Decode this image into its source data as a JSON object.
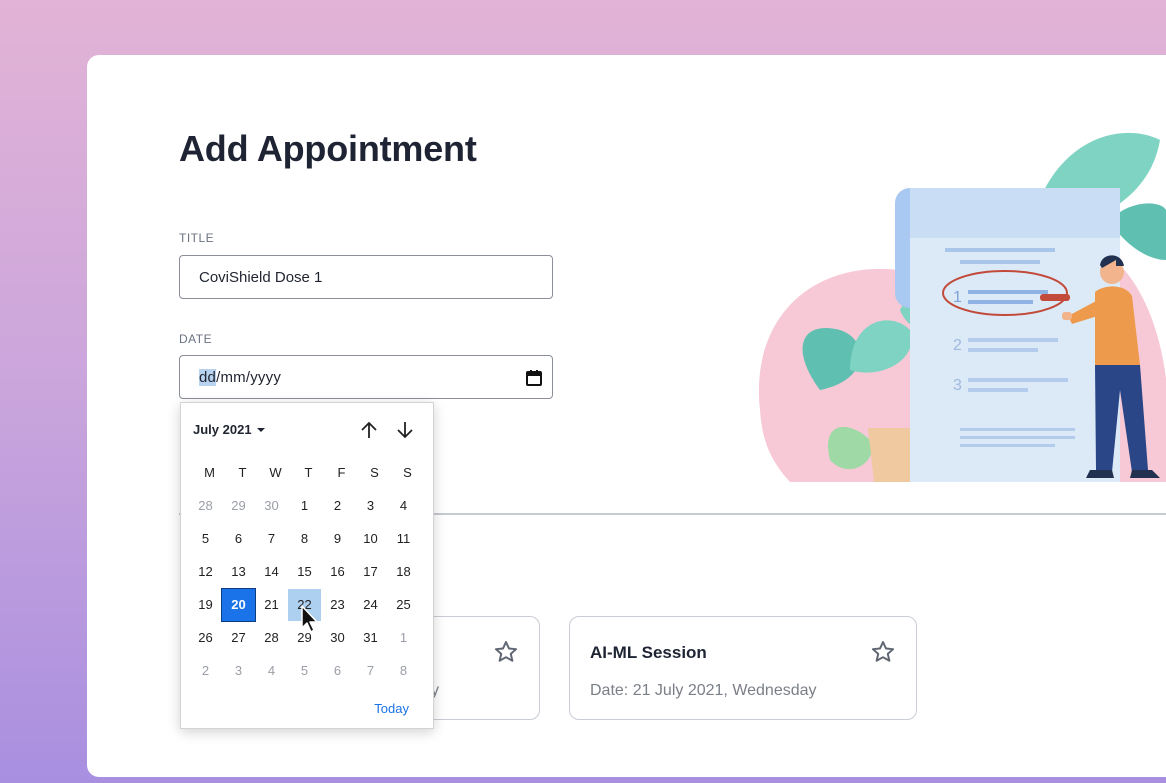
{
  "page": {
    "title": "Add Appointment"
  },
  "form": {
    "title_label": "TITLE",
    "title_value": "CoviShield Dose 1",
    "date_label": "DATE",
    "date_segments": [
      "dd",
      "/mm/yyyy"
    ]
  },
  "datepicker": {
    "month_label": "July 2021",
    "weekdays": [
      "M",
      "T",
      "W",
      "T",
      "F",
      "S",
      "S"
    ],
    "weeks": [
      [
        "28",
        "29",
        "30",
        "1",
        "2",
        "3",
        "4"
      ],
      [
        "5",
        "6",
        "7",
        "8",
        "9",
        "10",
        "11"
      ],
      [
        "12",
        "13",
        "14",
        "15",
        "16",
        "17",
        "18"
      ],
      [
        "19",
        "20",
        "21",
        "22",
        "23",
        "24",
        "25"
      ],
      [
        "26",
        "27",
        "28",
        "29",
        "30",
        "31",
        "1"
      ],
      [
        "2",
        "3",
        "4",
        "5",
        "6",
        "7",
        "8"
      ]
    ],
    "selected_day": "20",
    "hovered_day": "22",
    "today_label": "Today"
  },
  "appointments": [
    {
      "title": "",
      "date_fragment": "y"
    },
    {
      "title": "AI-ML Session",
      "date": "Date: 21 July 2021, Wednesday"
    }
  ],
  "colors": {
    "accent": "#1a73e8",
    "title_text": "#1e2433",
    "illustration_teal": "#5fbfb0",
    "illustration_pink": "#f7c9d6",
    "illustration_orange": "#ee9a4c"
  },
  "icons": [
    "calendar-icon",
    "chevron-down-icon",
    "arrow-up-icon",
    "arrow-down-icon",
    "star-icon",
    "cursor-icon"
  ]
}
